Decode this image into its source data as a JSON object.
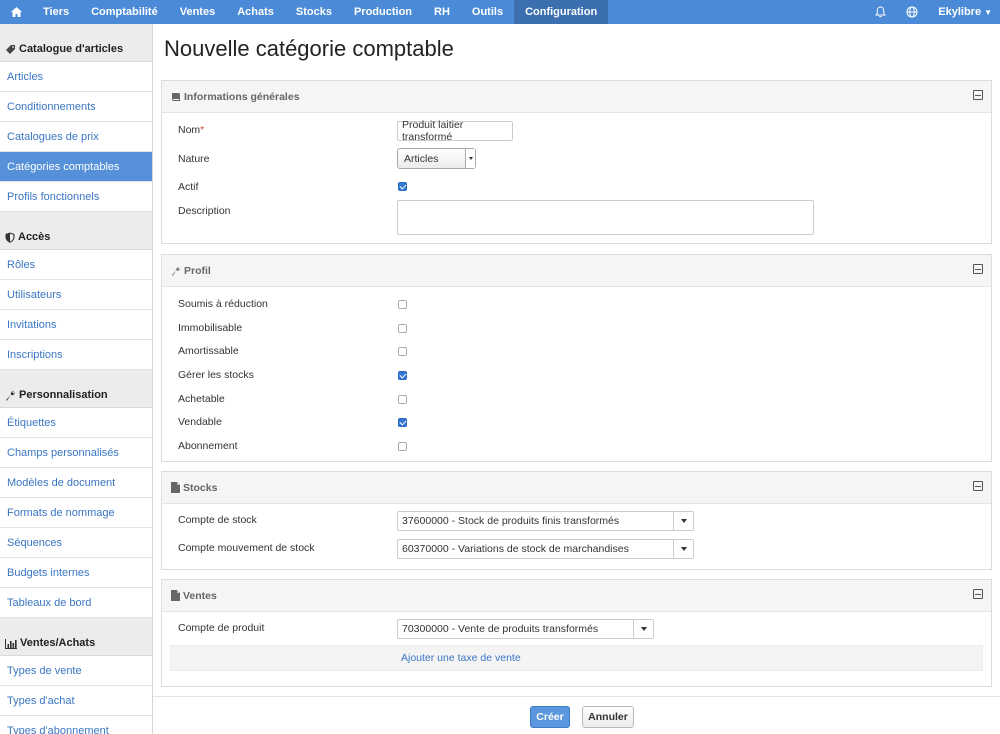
{
  "topbar": {
    "nav": [
      {
        "label": "Tiers",
        "active": false
      },
      {
        "label": "Comptabilité",
        "active": false
      },
      {
        "label": "Ventes",
        "active": false
      },
      {
        "label": "Achats",
        "active": false
      },
      {
        "label": "Stocks",
        "active": false
      },
      {
        "label": "Production",
        "active": false
      },
      {
        "label": "RH",
        "active": false
      },
      {
        "label": "Outils",
        "active": false
      },
      {
        "label": "Configuration",
        "active": true
      }
    ],
    "user": "Ekylibre"
  },
  "sidebar": {
    "sections": [
      {
        "title": "Catalogue d'articles",
        "icon": "tag-icon",
        "items": [
          "Articles",
          "Conditionnements",
          "Catalogues de prix",
          "Catégories comptables",
          "Profils fonctionnels"
        ]
      },
      {
        "title": "Accès",
        "icon": "shield-icon",
        "items": [
          "Rôles",
          "Utilisateurs",
          "Invitations",
          "Inscriptions"
        ]
      },
      {
        "title": "Personnalisation",
        "icon": "wrench-icon",
        "items": [
          "Étiquettes",
          "Champs personnalisés",
          "Modèles de document",
          "Formats de nommage",
          "Séquences",
          "Budgets internes",
          "Tableaux de bord"
        ]
      },
      {
        "title": "Ventes/Achats",
        "icon": "bar-chart-icon",
        "items": [
          "Types de vente",
          "Types d'achat",
          "Types d'abonnement"
        ]
      }
    ],
    "active_item": "Catégories comptables"
  },
  "page": {
    "title": "Nouvelle catégorie comptable"
  },
  "general": {
    "title": "Informations générales",
    "name_label": "Nom",
    "name_required_mark": "*",
    "name_value": "Produit laitier transformé",
    "nature_label": "Nature",
    "nature_value": "Articles",
    "active_label": "Actif",
    "active_checked": true,
    "description_label": "Description",
    "description_value": ""
  },
  "profile": {
    "title": "Profil",
    "fields": [
      {
        "label": "Soumis à réduction",
        "checked": false
      },
      {
        "label": "Immobilisable",
        "checked": false
      },
      {
        "label": "Amortissable",
        "checked": false
      },
      {
        "label": "Gérer les stocks",
        "checked": true
      },
      {
        "label": "Achetable",
        "checked": false
      },
      {
        "label": "Vendable",
        "checked": true
      },
      {
        "label": "Abonnement",
        "checked": false
      }
    ]
  },
  "stocks": {
    "title": "Stocks",
    "stock_account_label": "Compte de stock",
    "stock_account_value": "37600000 - Stock de produits finis transformés",
    "movement_account_label": "Compte mouvement de stock",
    "movement_account_value": "60370000 - Variations de stock de marchandises"
  },
  "sales": {
    "title": "Ventes",
    "product_account_label": "Compte de produit",
    "product_account_value": "70300000 - Vente de produits transformés",
    "add_tax_label": "Ajouter une taxe de vente"
  },
  "actions": {
    "create": "Créer",
    "cancel": "Annuler"
  }
}
